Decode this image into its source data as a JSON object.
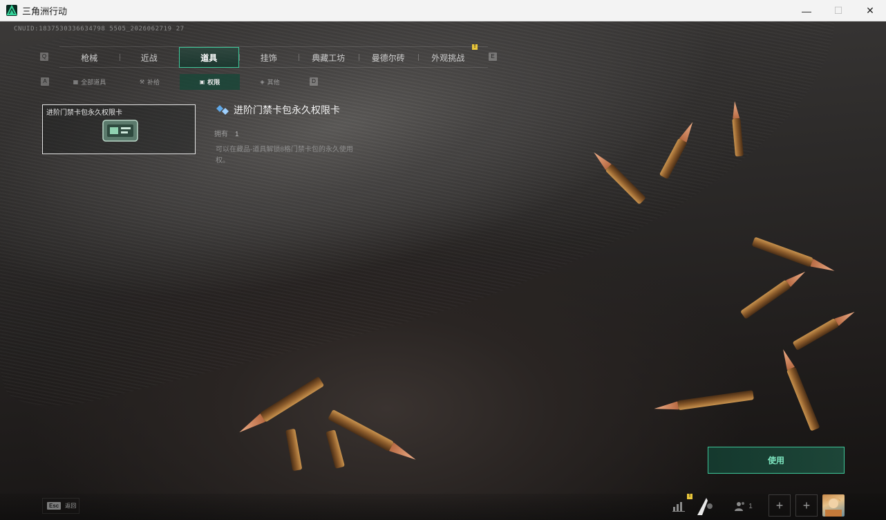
{
  "window": {
    "title": "三角洲行动",
    "minimize": "—",
    "maximize": "☐",
    "close": "✕"
  },
  "cnuid": "CNUID:1837530336634798 5505_2026062719 27",
  "main_tabs": {
    "key_left": "Q",
    "key_right": "E",
    "items": [
      {
        "label": "枪械"
      },
      {
        "label": "近战"
      },
      {
        "label": "道具",
        "active": true
      },
      {
        "label": "挂饰"
      },
      {
        "label": "典藏工坊"
      },
      {
        "label": "曼德尔砖"
      },
      {
        "label": "外观挑战"
      }
    ],
    "badge": "!"
  },
  "sub_tabs": {
    "key_left": "A",
    "key_right": "D",
    "items": [
      {
        "label": "全部道具"
      },
      {
        "label": "补给"
      },
      {
        "label": "权限",
        "active": true
      },
      {
        "label": "其他"
      }
    ]
  },
  "item_card": {
    "title": "进阶门禁卡包永久权限卡"
  },
  "detail": {
    "title": "进阶门禁卡包永久权限卡",
    "owned_label": "拥有",
    "owned_value": "1",
    "description": "可以在藏品-道具解锁8格门禁卡包的永久使用权。"
  },
  "use_button": {
    "label": "使用"
  },
  "bottom": {
    "esc_key": "Esc",
    "esc_label": "返回",
    "friends_count": "1",
    "badge": "!"
  },
  "colors": {
    "accent": "#3fc89a",
    "accent_text": "#7fe8c2",
    "badge": "#e8c53a"
  },
  "icons": [
    "app-logo-icon",
    "diamond-rarity-icon",
    "keycard-icon",
    "stats-icon",
    "friends-icon",
    "plus-icon",
    "avatar"
  ]
}
